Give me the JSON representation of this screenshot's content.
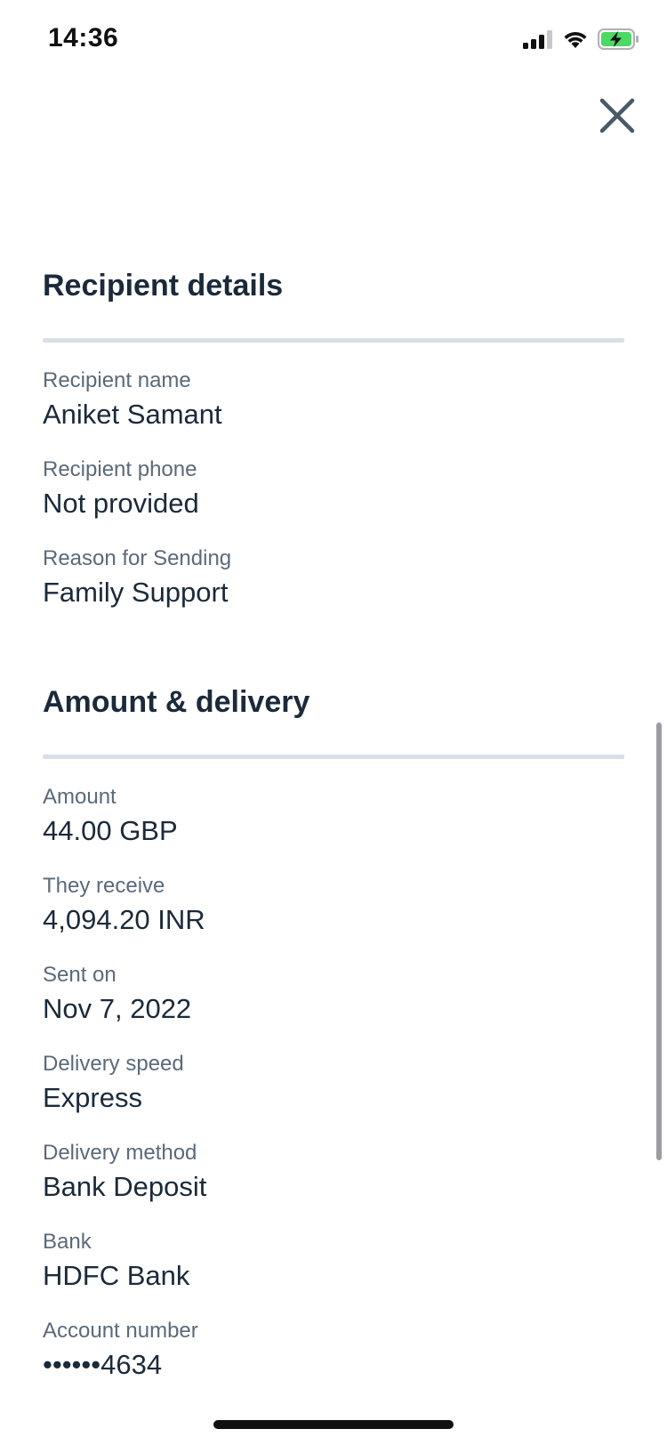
{
  "status_bar": {
    "time": "14:36",
    "icons": [
      "cellular-signal-icon",
      "wifi-icon",
      "battery-charging-icon"
    ],
    "battery_color": "#4cd964"
  },
  "close_icon": "close-icon",
  "recipient_section": {
    "title": "Recipient details",
    "fields": [
      {
        "label": "Recipient name",
        "value": "Aniket Samant"
      },
      {
        "label": "Recipient phone",
        "value": "Not provided"
      },
      {
        "label": "Reason for Sending",
        "value": "Family Support"
      }
    ]
  },
  "amount_section": {
    "title": "Amount & delivery",
    "fields": [
      {
        "label": "Amount",
        "value": "44.00 GBP"
      },
      {
        "label": "They receive",
        "value": "4,094.20 INR"
      },
      {
        "label": "Sent on",
        "value": "Nov 7, 2022"
      },
      {
        "label": "Delivery speed",
        "value": "Express"
      },
      {
        "label": "Delivery method",
        "value": "Bank Deposit"
      },
      {
        "label": "Bank",
        "value": "HDFC Bank"
      },
      {
        "label": "Account number",
        "value": "••••••4634"
      }
    ]
  },
  "colors": {
    "text_primary": "#1b2a3a",
    "text_secondary": "#5a6a7a",
    "divider": "#d7e0e8",
    "icon": "#4a5968"
  }
}
